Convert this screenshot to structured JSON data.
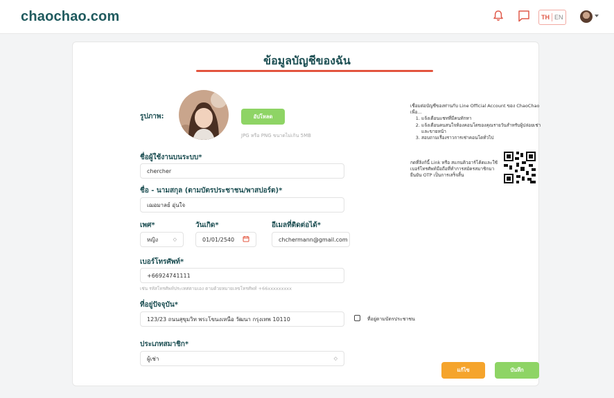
{
  "header": {
    "logo": "chaochao.com",
    "lang_th": "TH",
    "lang_en": "EN",
    "brand_color": "#1f5a5e",
    "accent_color": "#e05a4a"
  },
  "page": {
    "title": "ข้อมูลบัญชีของฉัน"
  },
  "photo": {
    "label": "รูปภาพ:",
    "upload_button": "อัปโหลด",
    "hint": "JPG หรือ PNG ขนาดไม่เกิน 5MB"
  },
  "username": {
    "label": "ชื่อผู้ใช้งานบนระบบ*",
    "value": "chercher"
  },
  "fullname": {
    "label": "ชื่อ - นามสกุล (ตามบัตรประชาชน/พาสปอร์ต)*",
    "value": "เฌอมาลย์ อุ่นใจ"
  },
  "gender": {
    "label": "เพศ*",
    "value": "หญิง"
  },
  "birthdate": {
    "label": "วันเกิด*",
    "value": "01/01/2540"
  },
  "email": {
    "label": "อีเมลที่ติดต่อได้*",
    "value": "chchermann@gmail.com"
  },
  "phone": {
    "label": "เบอร์โทรศัพท์*",
    "value": "+66924741111",
    "hint": "เช่น รหัสโทรศัพท์ประเทศตามเอง ตามด้วยหมายเลขโทรศัพท์ +66xxxxxxxxx"
  },
  "address": {
    "label": "ที่อยู่ปัจจุบัน*",
    "value": "123/23 ถนนสุขุมวิท พระโขนงเหนือ วัฒนา กรุงเทพ 10110",
    "checkbox_label": "ที่อยู่ตามบัตรประชาชน"
  },
  "membership": {
    "label": "ประเภทสมาชิก*",
    "value": "ผู้เช่า"
  },
  "line_info": {
    "intro": "เชื่อมต่อบัญชีของท่านกับ Line Official Account ของ ChaoChao เพื่อ...",
    "items": [
      "แจ้งเตือนแชทที่มีคนทักหา",
      "แจ้งเตือนคนสนใจห้องคอนโดของคุณรายวันสำหรับผู้ปล่อยเช่าและขายหน้า",
      "สอบถามเรื่องราวการเช่าคอนโดทั่วไป"
    ],
    "link_text": "กดที่ลิงก์นี้ Link หรือ สแกนคิวอาร์โค้ดและใช้เบอร์โทรศัพท์มือถือที่ทำการสมัครสมาชิกมายืนยัน OTP เป็นการเสร็จสิ้น"
  },
  "actions": {
    "cancel": "แก้ไข",
    "save": "บันทึก"
  }
}
